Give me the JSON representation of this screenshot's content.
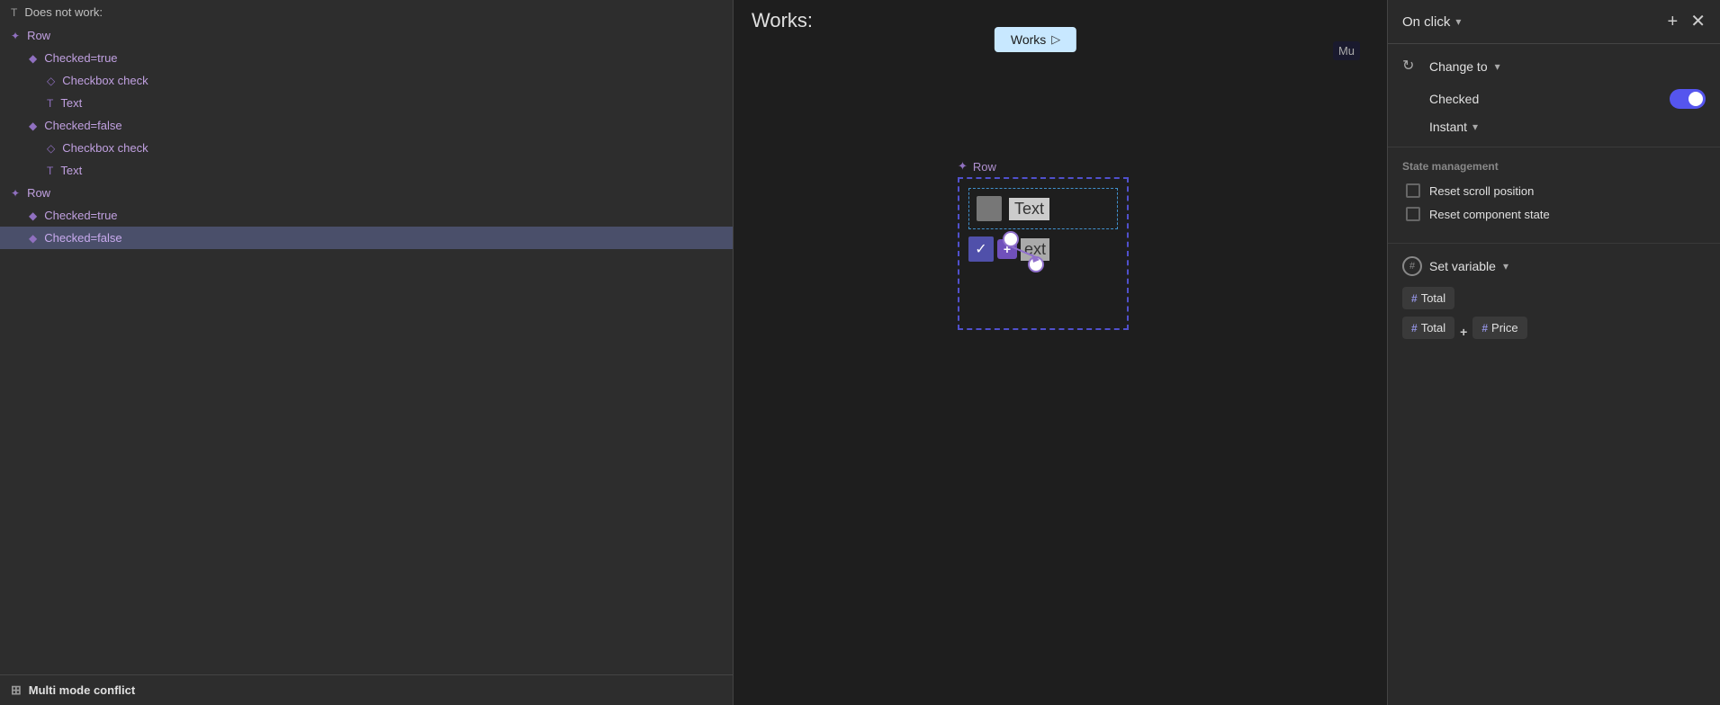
{
  "leftPanel": {
    "doesNotWork": "Does not work:",
    "items": [
      {
        "level": 0,
        "icon": "✦",
        "label": "Row",
        "type": "row"
      },
      {
        "level": 1,
        "icon": "◆",
        "label": "Checked=true",
        "type": "variant"
      },
      {
        "level": 2,
        "icon": "◇",
        "label": "Checkbox check",
        "type": "component"
      },
      {
        "level": 2,
        "icon": "T",
        "label": "Text",
        "type": "text"
      },
      {
        "level": 1,
        "icon": "◆",
        "label": "Checked=false",
        "type": "variant"
      },
      {
        "level": 2,
        "icon": "◇",
        "label": "Checkbox check",
        "type": "component"
      },
      {
        "level": 2,
        "icon": "T",
        "label": "Text",
        "type": "text"
      },
      {
        "level": 0,
        "icon": "✦",
        "label": "Row",
        "type": "row"
      },
      {
        "level": 1,
        "icon": "◆",
        "label": "Checked=true",
        "type": "variant"
      },
      {
        "level": 1,
        "icon": "◆",
        "label": "Checked=false",
        "type": "variant",
        "selected": true
      }
    ],
    "bottomBar": "Multi mode conflict"
  },
  "centerPanel": {
    "worksLabel": "Works:",
    "muLabel": "Mu",
    "worksButtonLabel": "Works",
    "rowLabel": "Row",
    "textLabel": "Text",
    "textLabel2": "ext"
  },
  "rightPanel": {
    "onClickLabel": "On click",
    "changeTo": "Change to",
    "checkedLabel": "Checked",
    "instantLabel": "Instant",
    "stateManagementTitle": "State management",
    "resetScrollLabel": "Reset scroll position",
    "resetComponentLabel": "Reset component state",
    "setVariableLabel": "Set variable",
    "totalLabel": "Total",
    "priceLabel": "Price",
    "plusLabel": "+"
  }
}
